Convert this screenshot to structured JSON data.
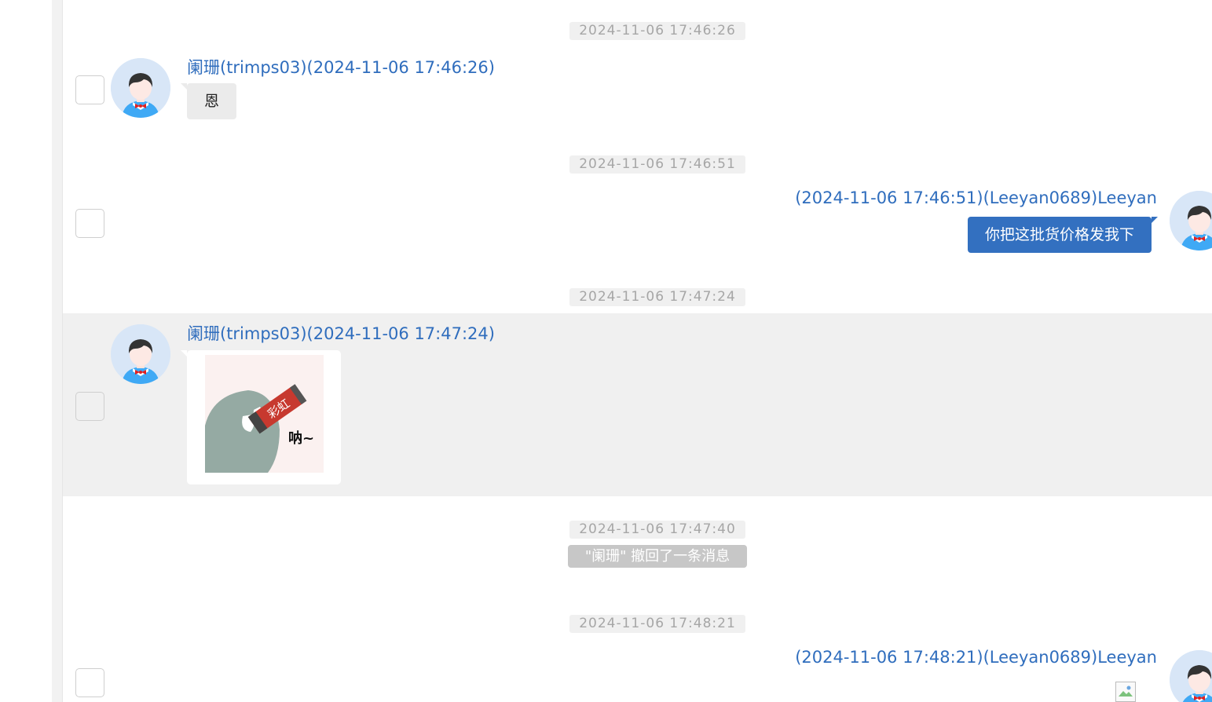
{
  "messages": [
    {
      "timestamp": "2024-11-06 17:46:26",
      "sender": "阑珊(trimps03)(2024-11-06 17:46:26)",
      "text": "恩"
    },
    {
      "timestamp": "2024-11-06 17:46:51",
      "sender": "(2024-11-06 17:46:51)(Leeyan0689)Leeyan",
      "text": "你把这批货价格发我下"
    },
    {
      "timestamp": "2024-11-06 17:47:24",
      "sender": "阑珊(trimps03)(2024-11-06 17:47:24)",
      "sticker_text": "呐~",
      "sticker_label": "彩虹"
    },
    {
      "timestamp": "2024-11-06 17:47:40",
      "recall_notice": "\"阑珊\" 撤回了一条消息"
    },
    {
      "timestamp": "2024-11-06 17:48:21",
      "sender": "(2024-11-06 17:48:21)(Leeyan0689)Leeyan"
    }
  ],
  "colors": {
    "accent": "#3370c0",
    "sender_link": "#2f6dbd",
    "incoming_bubble": "#ebebeb",
    "timestamp_text": "#a6a6a6",
    "highlight_row": "#f0f0f0",
    "recall_badge": "#c7c7c7"
  },
  "icons": {
    "avatar": "user-avatar-icon",
    "broken_image": "broken-image-icon"
  }
}
